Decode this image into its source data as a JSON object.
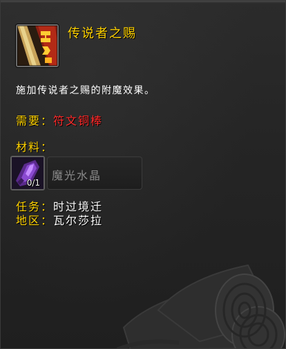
{
  "spell": {
    "title": "传说者之赐",
    "icon": "rune-weapon-icon",
    "description": "施加传说者之赐的附魔效果。"
  },
  "requires": {
    "label": "需要：",
    "value": "符文铜棒"
  },
  "materials": {
    "label": "材料：",
    "reagents": [
      {
        "name": "魔光水晶",
        "count": "0/1",
        "icon": "purple-crystal-icon"
      }
    ]
  },
  "source": {
    "quest_label": "任务：",
    "quest_value": "时过境迁",
    "zone_label": "地区：",
    "zone_value": "瓦尔莎拉"
  },
  "colors": {
    "title": "#ffd200",
    "label": "#ffd200",
    "missing_requirement": "#ff2a2a",
    "body_text": "#ffffff",
    "reagent_name": "#8a8a8a"
  }
}
